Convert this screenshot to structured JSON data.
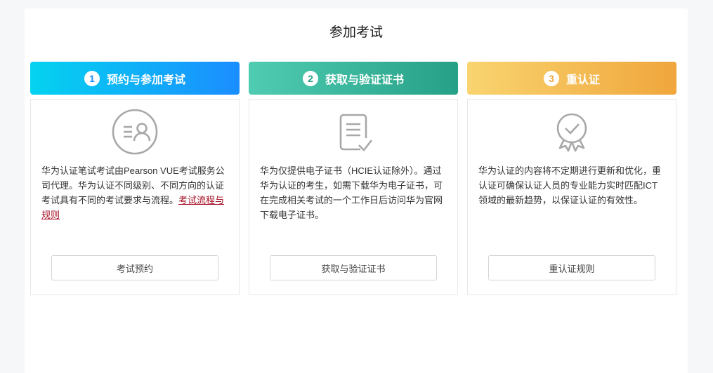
{
  "page": {
    "title": "参加考试",
    "background_color": "#f6f7f9",
    "link_color": "#a50c23"
  },
  "cards": [
    {
      "step": "1",
      "header": "预约与参加考试",
      "gradient_start": "#04d3f0",
      "gradient_end": "#1b8dff",
      "icon": "registration-person-icon",
      "description": "华为认证笔试考试由Pearson VUE考试服务公司代理。华为认证不同级别、不同方向的认证考试具有不同的考试要求与流程。",
      "link_label": "考试流程与规则",
      "button_label": "考试预约"
    },
    {
      "step": "2",
      "header": "获取与验证证书",
      "gradient_start": "#4fccb2",
      "gradient_end": "#26a086",
      "icon": "certificate-document-check-icon",
      "description": "华为仅提供电子证书（HCIE认证除外）。通过华为认证的考生，如需下载华为电子证书，可在完成相关考试的一个工作日后访问华为官网下载电子证书。",
      "button_label": "获取与验证证书"
    },
    {
      "step": "3",
      "header": "重认证",
      "gradient_start": "#f9d470",
      "gradient_end": "#f0a63c",
      "icon": "medal-check-icon",
      "description": "华为认证的内容将不定期进行更新和优化，重认证可确保认证人员的专业能力实时匹配ICT领域的最新趋势，以保证认证的有效性。",
      "button_label": "重认证规则"
    }
  ]
}
